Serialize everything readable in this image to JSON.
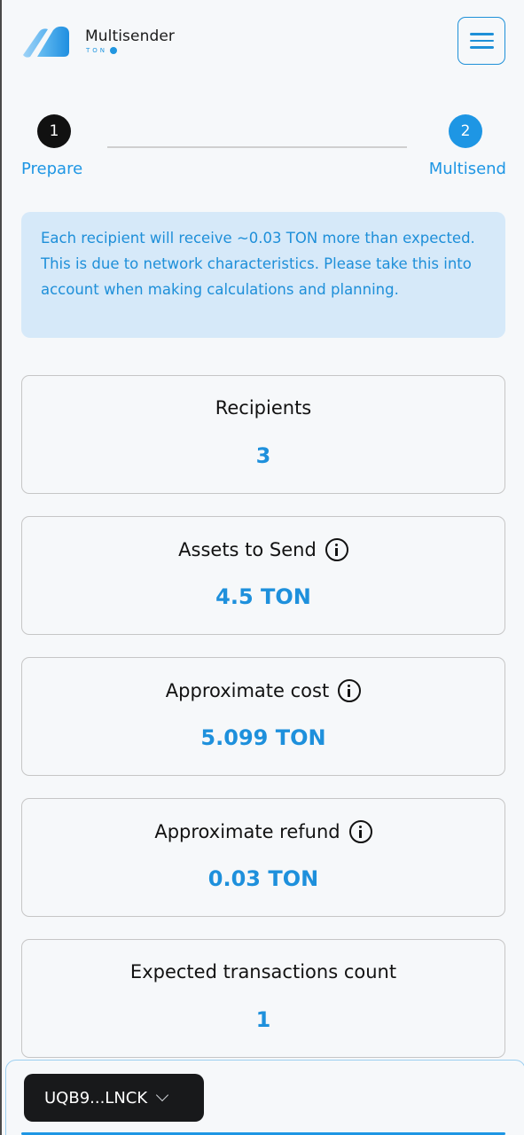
{
  "header": {
    "brand_name": "Multisender",
    "brand_sub": "TON",
    "menu_icon": "hamburger-icon",
    "colors": {
      "accent": "#1e96e4",
      "banner_bg": "#d6e9f9",
      "text": "#121212"
    }
  },
  "stepper": {
    "steps": [
      {
        "number": "1",
        "label": "Prepare",
        "state": "done"
      },
      {
        "number": "2",
        "label": "Multisend",
        "state": "active"
      }
    ]
  },
  "banner": {
    "text": "Each recipient will receive ~0.03 TON more than expected. This is due to network characteristics. Please take this into account when making calculations and planning."
  },
  "stats": [
    {
      "title": "Recipients",
      "value": "3",
      "has_info": false
    },
    {
      "title": "Assets to Send",
      "value": "4.5 TON",
      "has_info": true
    },
    {
      "title": "Approximate cost",
      "value": "5.099 TON",
      "has_info": true
    },
    {
      "title": "Approximate refund",
      "value": "0.03 TON",
      "has_info": true
    },
    {
      "title": "Expected transactions count",
      "value": "1",
      "has_info": false
    }
  ],
  "wallet": {
    "address": "UQB9...LNCK",
    "icon": "chevron-down-icon"
  }
}
